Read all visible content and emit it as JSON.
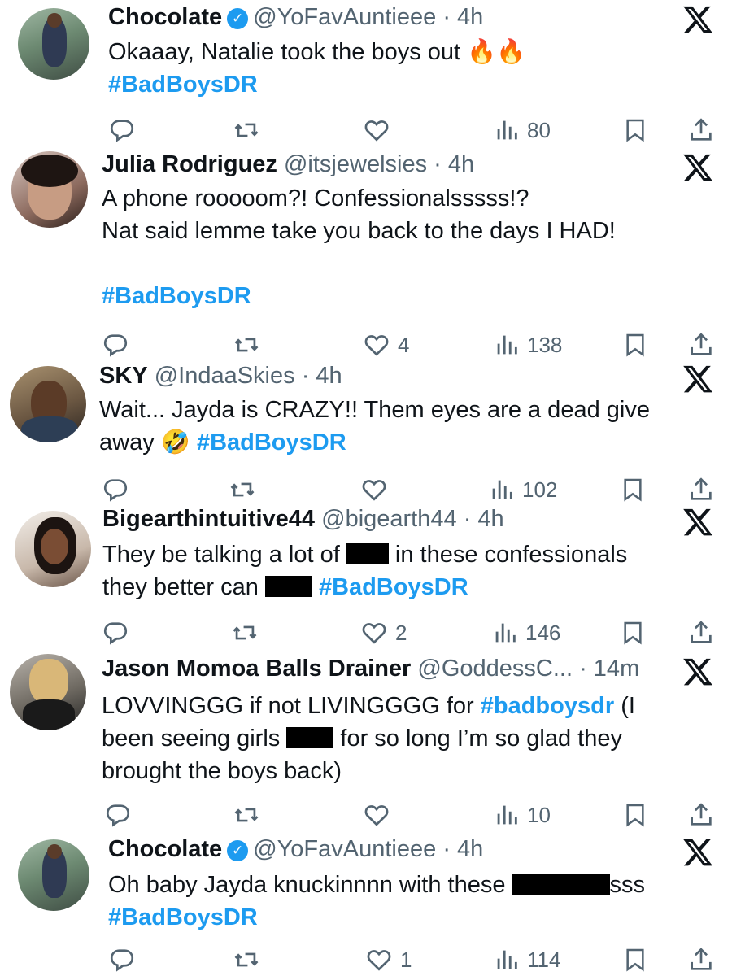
{
  "tweets": [
    {
      "name": "Chocolate",
      "verified": true,
      "handle": "@YoFavAuntieee",
      "time": "· 4h",
      "lines": [
        "Okaaay, Natalie took the boys out",
        "#BadBoysDR"
      ],
      "emoji": "🔥🔥",
      "likes": "",
      "views": "80"
    },
    {
      "name": "Julia Rodriguez",
      "verified": false,
      "handle": "@itsjewelsies",
      "time": "· 4h",
      "lines": [
        "A phone rooooom?! Confessionalsssss!?",
        "Nat said lemme take you back to the days I HAD!",
        "#BadBoysDR"
      ],
      "likes": "4",
      "views": "138"
    },
    {
      "name": "SKY",
      "verified": false,
      "handle": "@IndaaSkies",
      "time": "· 4h",
      "lines": [
        "Wait... Jayda is CRAZY!! Them eyes are a dead give",
        "away",
        "🤣",
        "#BadBoysDR"
      ],
      "likes": "",
      "views": "102"
    },
    {
      "name": "Bigearthintuitive44",
      "verified": false,
      "handle": "@bigearth44",
      "time": "· 4h",
      "lines": [
        "They be talking a lot of",
        "in these confessionals",
        "they better can",
        "#BadBoysDR"
      ],
      "likes": "2",
      "views": "146"
    },
    {
      "name": "Jason Momoa Balls Drainer",
      "verified": false,
      "handle": "@GoddessC...",
      "time": "· 14m",
      "lines": [
        "LOVVINGGG if not LIVINGGGG for",
        "#badboysdr",
        "(I",
        "been seeing girls",
        "for so long I’m so glad they",
        "brought the boys back)"
      ],
      "likes": "",
      "views": "10"
    },
    {
      "name": "Chocolate",
      "verified": true,
      "handle": "@YoFavAuntieee",
      "time": "· 4h",
      "lines": [
        "Oh baby Jayda knuckinnnn with these",
        "sss",
        "#BadBoysDR"
      ],
      "likes": "1",
      "views": "114"
    }
  ],
  "icons": {
    "reply": "reply-icon",
    "retweet": "retweet-icon",
    "like": "heart-icon",
    "views": "views-icon",
    "bookmark": "bookmark-icon",
    "share": "share-icon",
    "x": "x-logo-icon"
  },
  "colors": {
    "hashtag": "#1d9bf0",
    "secondary": "#536471",
    "verified": "#1d9bf0"
  }
}
